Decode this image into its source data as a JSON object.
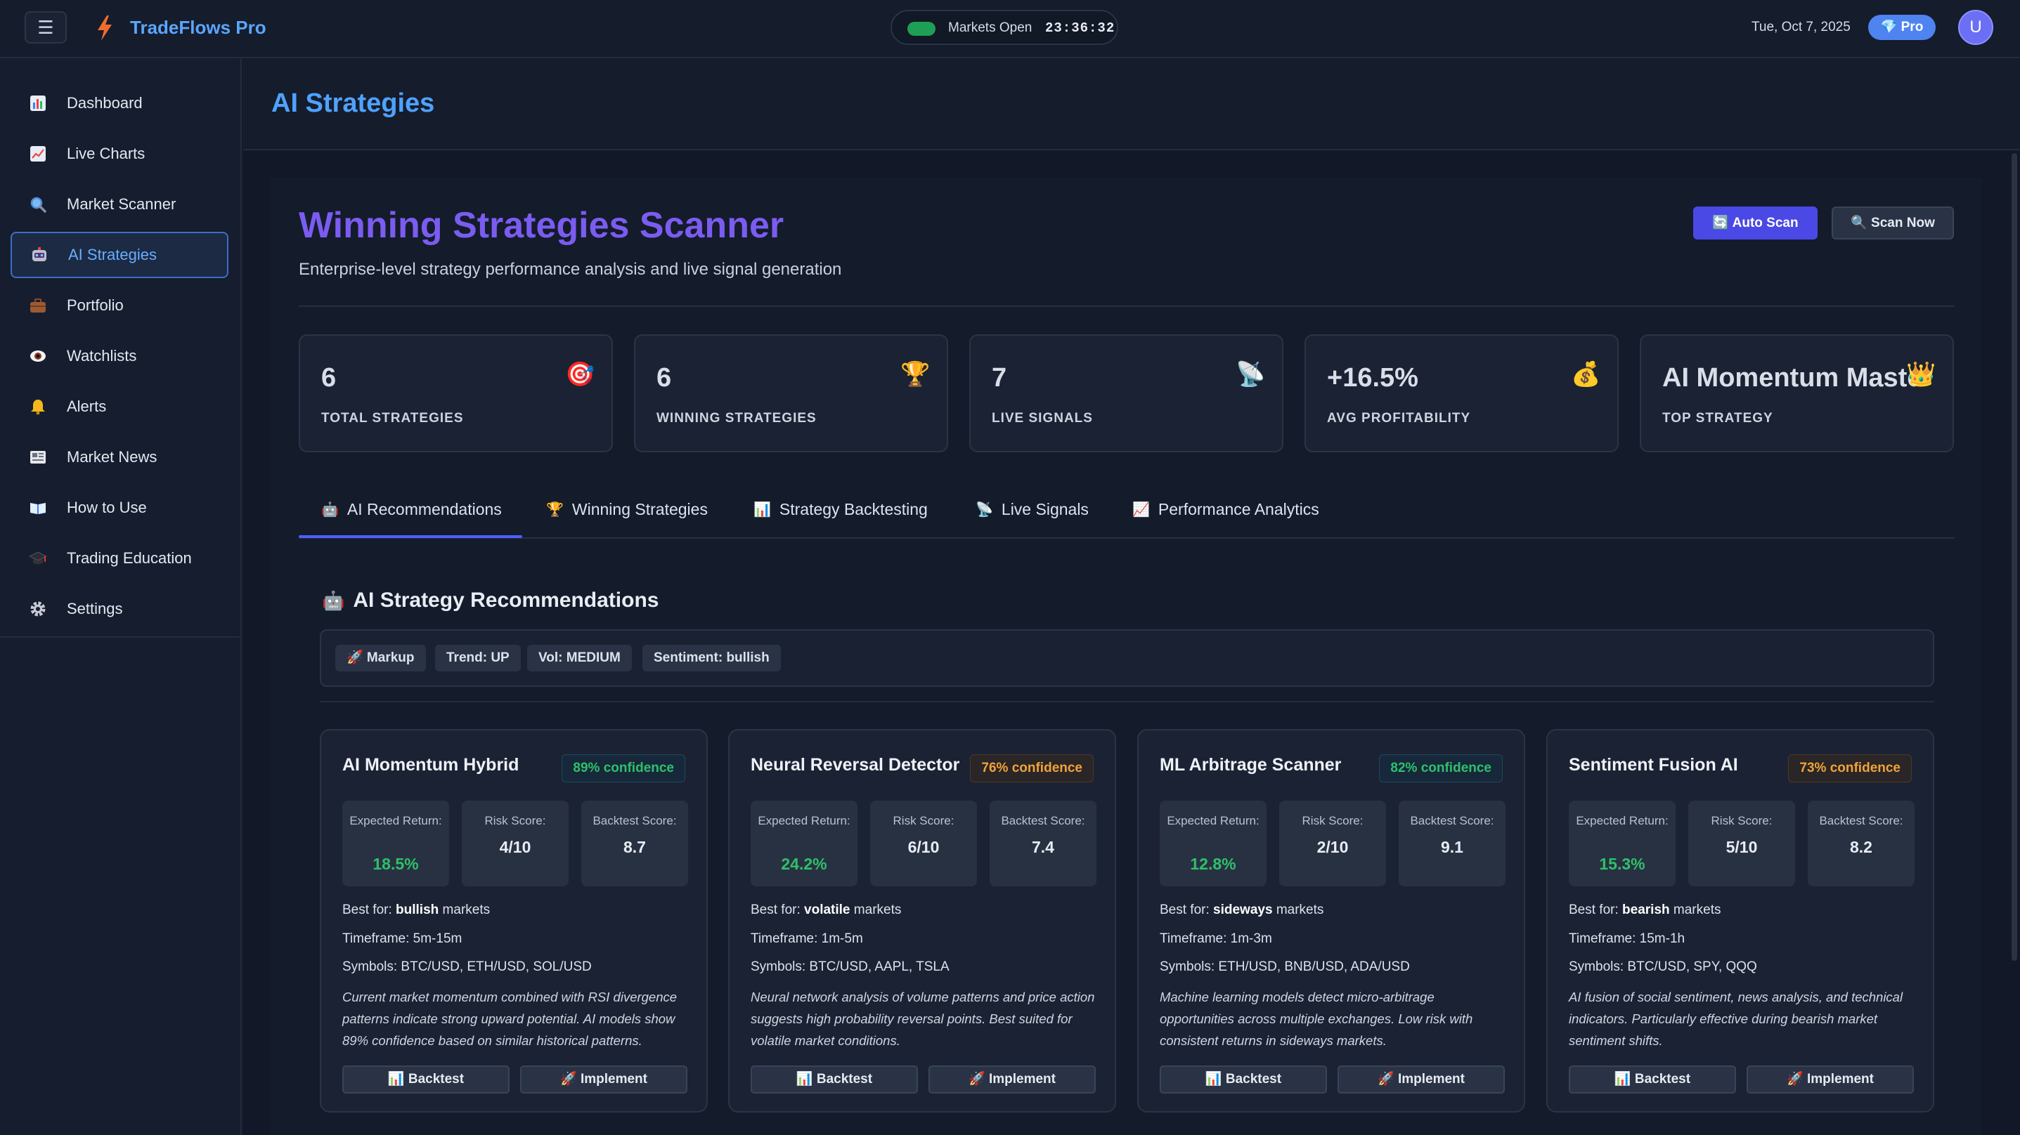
{
  "app": {
    "title": "TradeFlows Pro",
    "menu_icon": "hamburger-icon",
    "market_status": "Markets Open",
    "market_time": "23:36:32",
    "date": "Tue, Oct 7, 2025",
    "plan_badge": "💎 Pro",
    "avatar_initial": "U",
    "colors": {
      "accent": "#4ea2ff",
      "purple": "#7b5cf0",
      "green": "#2fc06a",
      "orange": "#f0a33a",
      "primary_button": "#4a49e6"
    }
  },
  "sidebar": {
    "items": [
      {
        "label": "Dashboard",
        "icon": "📊"
      },
      {
        "label": "Live Charts",
        "icon": "📈"
      },
      {
        "label": "Market Scanner",
        "icon": "🔍"
      },
      {
        "label": "AI Strategies",
        "icon": "🤖",
        "active": true
      },
      {
        "label": "Portfolio",
        "icon": "💼"
      },
      {
        "label": "Watchlists",
        "icon": "👁"
      },
      {
        "label": "Alerts",
        "icon": "🔔"
      },
      {
        "label": "Market News",
        "icon": "📰"
      },
      {
        "label": "How to Use",
        "icon": "📖"
      },
      {
        "label": "Trading Education",
        "icon": "🎓"
      },
      {
        "label": "Settings",
        "icon": "⚙"
      }
    ]
  },
  "page": {
    "title": "AI Strategies",
    "scanner_title": "Winning Strategies Scanner",
    "scanner_subtitle": "Enterprise-level strategy performance analysis and live signal generation",
    "auto_scan_label": "🔄 Auto Scan",
    "scan_now_label": "🔍 Scan Now"
  },
  "stats": [
    {
      "value": "6",
      "label": "TOTAL STRATEGIES",
      "icon": "🎯"
    },
    {
      "value": "6",
      "label": "WINNING STRATEGIES",
      "icon": "🏆"
    },
    {
      "value": "7",
      "label": "LIVE SIGNALS",
      "icon": "📡"
    },
    {
      "value": "+16.5%",
      "label": "AVG PROFITABILITY",
      "icon": "💰"
    },
    {
      "value": "AI Momentum Master",
      "label": "TOP STRATEGY",
      "icon": "👑"
    }
  ],
  "tabs": [
    {
      "label": "AI Recommendations",
      "icon": "🤖",
      "active": true
    },
    {
      "label": "Winning Strategies",
      "icon": "🏆"
    },
    {
      "label": "Strategy Backtesting",
      "icon": "📊"
    },
    {
      "label": "Live Signals",
      "icon": "📡"
    },
    {
      "label": "Performance Analytics",
      "icon": "📈"
    }
  ],
  "recommendations": {
    "title": "AI Strategy Recommendations",
    "title_icon": "🤖",
    "chips": [
      "🚀 Markup",
      "Trend: UP",
      "Vol: MEDIUM",
      "Sentiment: bullish"
    ],
    "labels": {
      "expected_return": "Expected Return:",
      "risk_score": "Risk Score:",
      "backtest_score": "Backtest Score:",
      "best_for": "Best for:",
      "markets": "markets",
      "timeframe": "Timeframe:",
      "symbols": "Symbols:",
      "backtest_btn": "📊 Backtest",
      "implement_btn": "🚀 Implement"
    },
    "cards": [
      {
        "name": "AI Momentum Hybrid",
        "confidence": "89% confidence",
        "confidence_color": "green",
        "expected_return": "18.5%",
        "risk_score": "4/10",
        "backtest_score": "8.7",
        "best_for": "bullish",
        "timeframe": "5m-15m",
        "symbols": "BTC/USD, ETH/USD, SOL/USD",
        "description": "Current market momentum combined with RSI divergence patterns indicate strong upward potential. AI models show 89% confidence based on similar historical patterns."
      },
      {
        "name": "Neural Reversal Detector",
        "confidence": "76% confidence",
        "confidence_color": "orange",
        "expected_return": "24.2%",
        "risk_score": "6/10",
        "backtest_score": "7.4",
        "best_for": "volatile",
        "timeframe": "1m-5m",
        "symbols": "BTC/USD, AAPL, TSLA",
        "description": "Neural network analysis of volume patterns and price action suggests high probability reversal points. Best suited for volatile market conditions."
      },
      {
        "name": "ML Arbitrage Scanner",
        "confidence": "82% confidence",
        "confidence_color": "green",
        "expected_return": "12.8%",
        "risk_score": "2/10",
        "backtest_score": "9.1",
        "best_for": "sideways",
        "timeframe": "1m-3m",
        "symbols": "ETH/USD, BNB/USD, ADA/USD",
        "description": "Machine learning models detect micro-arbitrage opportunities across multiple exchanges. Low risk with consistent returns in sideways markets."
      },
      {
        "name": "Sentiment Fusion AI",
        "confidence": "73% confidence",
        "confidence_color": "orange",
        "expected_return": "15.3%",
        "risk_score": "5/10",
        "backtest_score": "8.2",
        "best_for": "bearish",
        "timeframe": "15m-1h",
        "symbols": "BTC/USD, SPY, QQQ",
        "description": "AI fusion of social sentiment, news analysis, and technical indicators. Particularly effective during bearish market sentiment shifts."
      }
    ]
  }
}
